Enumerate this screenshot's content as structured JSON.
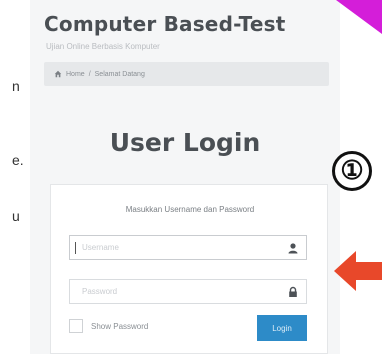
{
  "background": {
    "left_fragments": [
      "n",
      "e.",
      "u"
    ]
  },
  "header": {
    "title": "Computer Based-Test",
    "subtitle": "Ujian Online Berbasis Komputer"
  },
  "breadcrumb": {
    "home": "Home",
    "separator": "/",
    "current": "Selamat Datang"
  },
  "login": {
    "heading": "User Login",
    "instruction": "Masukkan Username dan Password",
    "username_placeholder": "Username",
    "password_placeholder": "Password",
    "show_password_label": "Show Password",
    "button_label": "Login"
  },
  "annotation": {
    "step_number": "①",
    "arrow_color": "#e8482a"
  },
  "icons": {
    "home": "home-icon",
    "user": "user-icon",
    "lock": "lock-icon"
  },
  "colors": {
    "accent": "#2d8bc8",
    "corner": "#d41ed9",
    "arrow": "#e8482a"
  }
}
